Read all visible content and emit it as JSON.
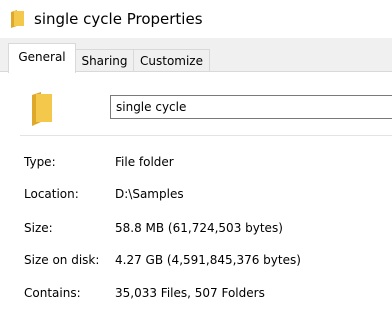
{
  "window": {
    "title": "single cycle Properties",
    "title_icon": "folder-icon"
  },
  "tabs": [
    {
      "label": "General",
      "active": true
    },
    {
      "label": "Sharing",
      "active": false
    },
    {
      "label": "Customize",
      "active": false
    }
  ],
  "general": {
    "folder_icon": "folder-icon",
    "name_value": "single cycle",
    "properties": [
      {
        "label": "Type:",
        "value": "File folder"
      },
      {
        "label": "Location:",
        "value": "D:\\Samples"
      },
      {
        "label": "Size:",
        "value": "58.8 MB (61,724,503 bytes)"
      },
      {
        "label": "Size on disk:",
        "value": "4.27 GB (4,591,845,376 bytes)"
      },
      {
        "label": "Contains:",
        "value": "35,033 Files, 507 Folders"
      }
    ]
  },
  "colors": {
    "folder_yellow": "#f4c84a",
    "folder_dark": "#e0a82a",
    "tab_background": "#f0f0f0",
    "border": "#d9d9d9"
  }
}
